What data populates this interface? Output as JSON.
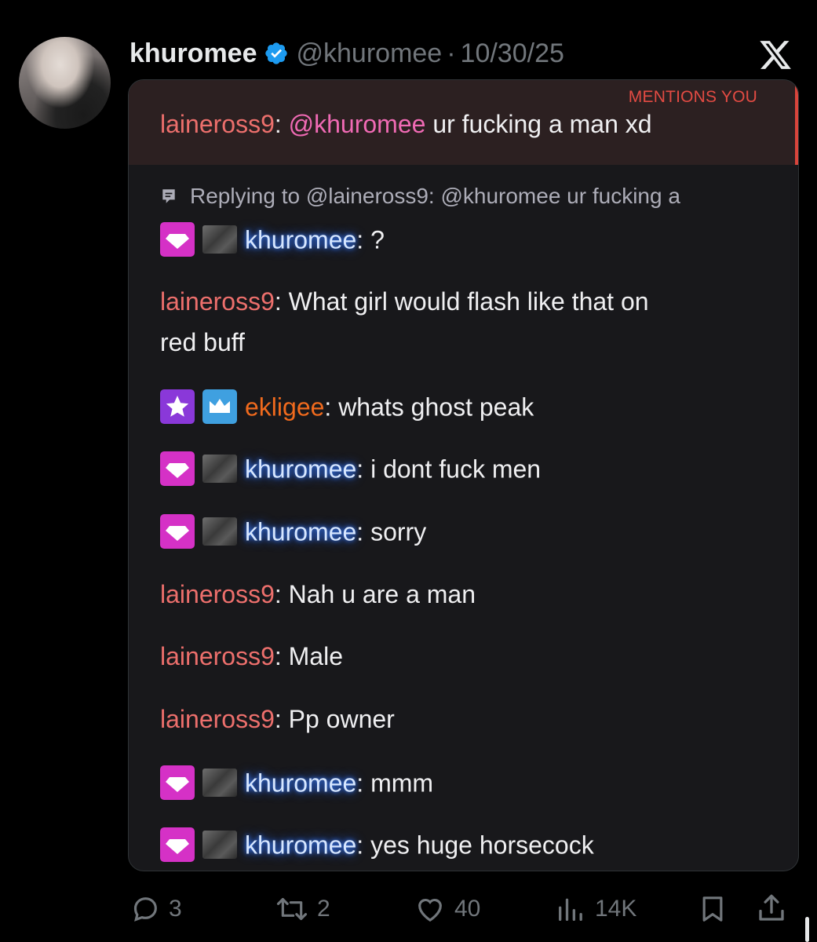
{
  "tweet": {
    "author_name": "khuromee",
    "handle": "@khuromee",
    "dot": "·",
    "date": "10/30/25"
  },
  "chat": {
    "mention_label": "MENTIONS YOU",
    "mention_message": {
      "user": "laineross9",
      "mention": "@khuromee",
      "text": " ur fucking a man xd"
    },
    "reply_context": "Replying to @laineross9: @khuromee ur fucking a",
    "messages": [
      {
        "user": "khuromee",
        "text": " ?"
      },
      {
        "user": "laineross9",
        "text": " What girl would flash like that on",
        "text2": "red buff"
      },
      {
        "user": "ekligee",
        "text": " whats ghost peak"
      },
      {
        "user": "khuromee",
        "text": " i dont fuck men"
      },
      {
        "user": "khuromee",
        "text": " sorry"
      },
      {
        "user": "laineross9",
        "text": " Nah u are a man"
      },
      {
        "user": "laineross9",
        "text": " Male"
      },
      {
        "user": "laineross9",
        "text": " Pp owner"
      },
      {
        "user": "khuromee",
        "text": " mmm"
      },
      {
        "user": "khuromee",
        "text": " yes huge horsecock"
      }
    ]
  },
  "actions": {
    "replies": "3",
    "reposts": "2",
    "likes": "40",
    "views": "14K"
  },
  "colors": {
    "background": "#000000",
    "card": "#18181b",
    "mention_banner": "#2c2021",
    "mention_accent": "#d9453c",
    "user_laineross9": "#ec6f6c",
    "user_ekligee": "#f06a1d",
    "user_khuromee_glow": "#2563ff",
    "verified_blue": "#1d9bf0",
    "muted": "#71767b"
  },
  "icons": [
    "verified-badge-icon",
    "x-logo-icon",
    "reply-context-icon",
    "gem-badge-icon",
    "star-badge-icon",
    "crown-badge-icon",
    "reply-icon",
    "repost-icon",
    "like-icon",
    "views-icon",
    "bookmark-icon",
    "share-icon"
  ]
}
